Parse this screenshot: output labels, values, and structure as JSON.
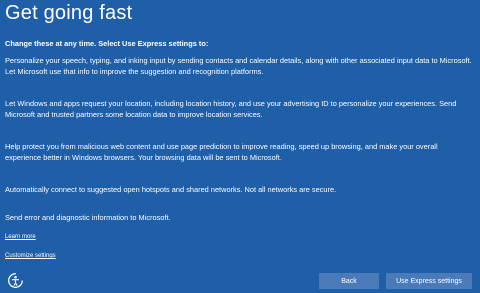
{
  "header": {
    "title": "Get going fast"
  },
  "intro": "Change these at any time. Select Use Express settings to:",
  "paragraphs": [
    "Personalize your speech, typing, and inking input by sending contacts and calendar details, along with other associated input data to Microsoft. Let Microsoft use that info to improve the suggestion and recognition platforms.",
    "Let Windows and apps request your location, including location history, and use your advertising ID to personalize your experiences. Send Microsoft and trusted partners some location data to improve location services.",
    "Help protect you from malicious web content and use page prediction to improve reading, speed up browsing, and make your overall experience better in Windows browsers. Your browsing data will be sent to Microsoft.",
    "Automatically connect to suggested open hotspots and shared networks. Not all networks are secure.",
    "Send error and diagnostic information to Microsoft."
  ],
  "links": {
    "learn_more": "Learn more",
    "customize": "Customize settings"
  },
  "buttons": {
    "back": "Back",
    "express": "Use Express settings"
  },
  "icons": {
    "accessibility": "ease-of-access-icon"
  },
  "colors": {
    "background": "#1e5fa8",
    "button": "#4a7ab8",
    "text": "#ffffff"
  }
}
